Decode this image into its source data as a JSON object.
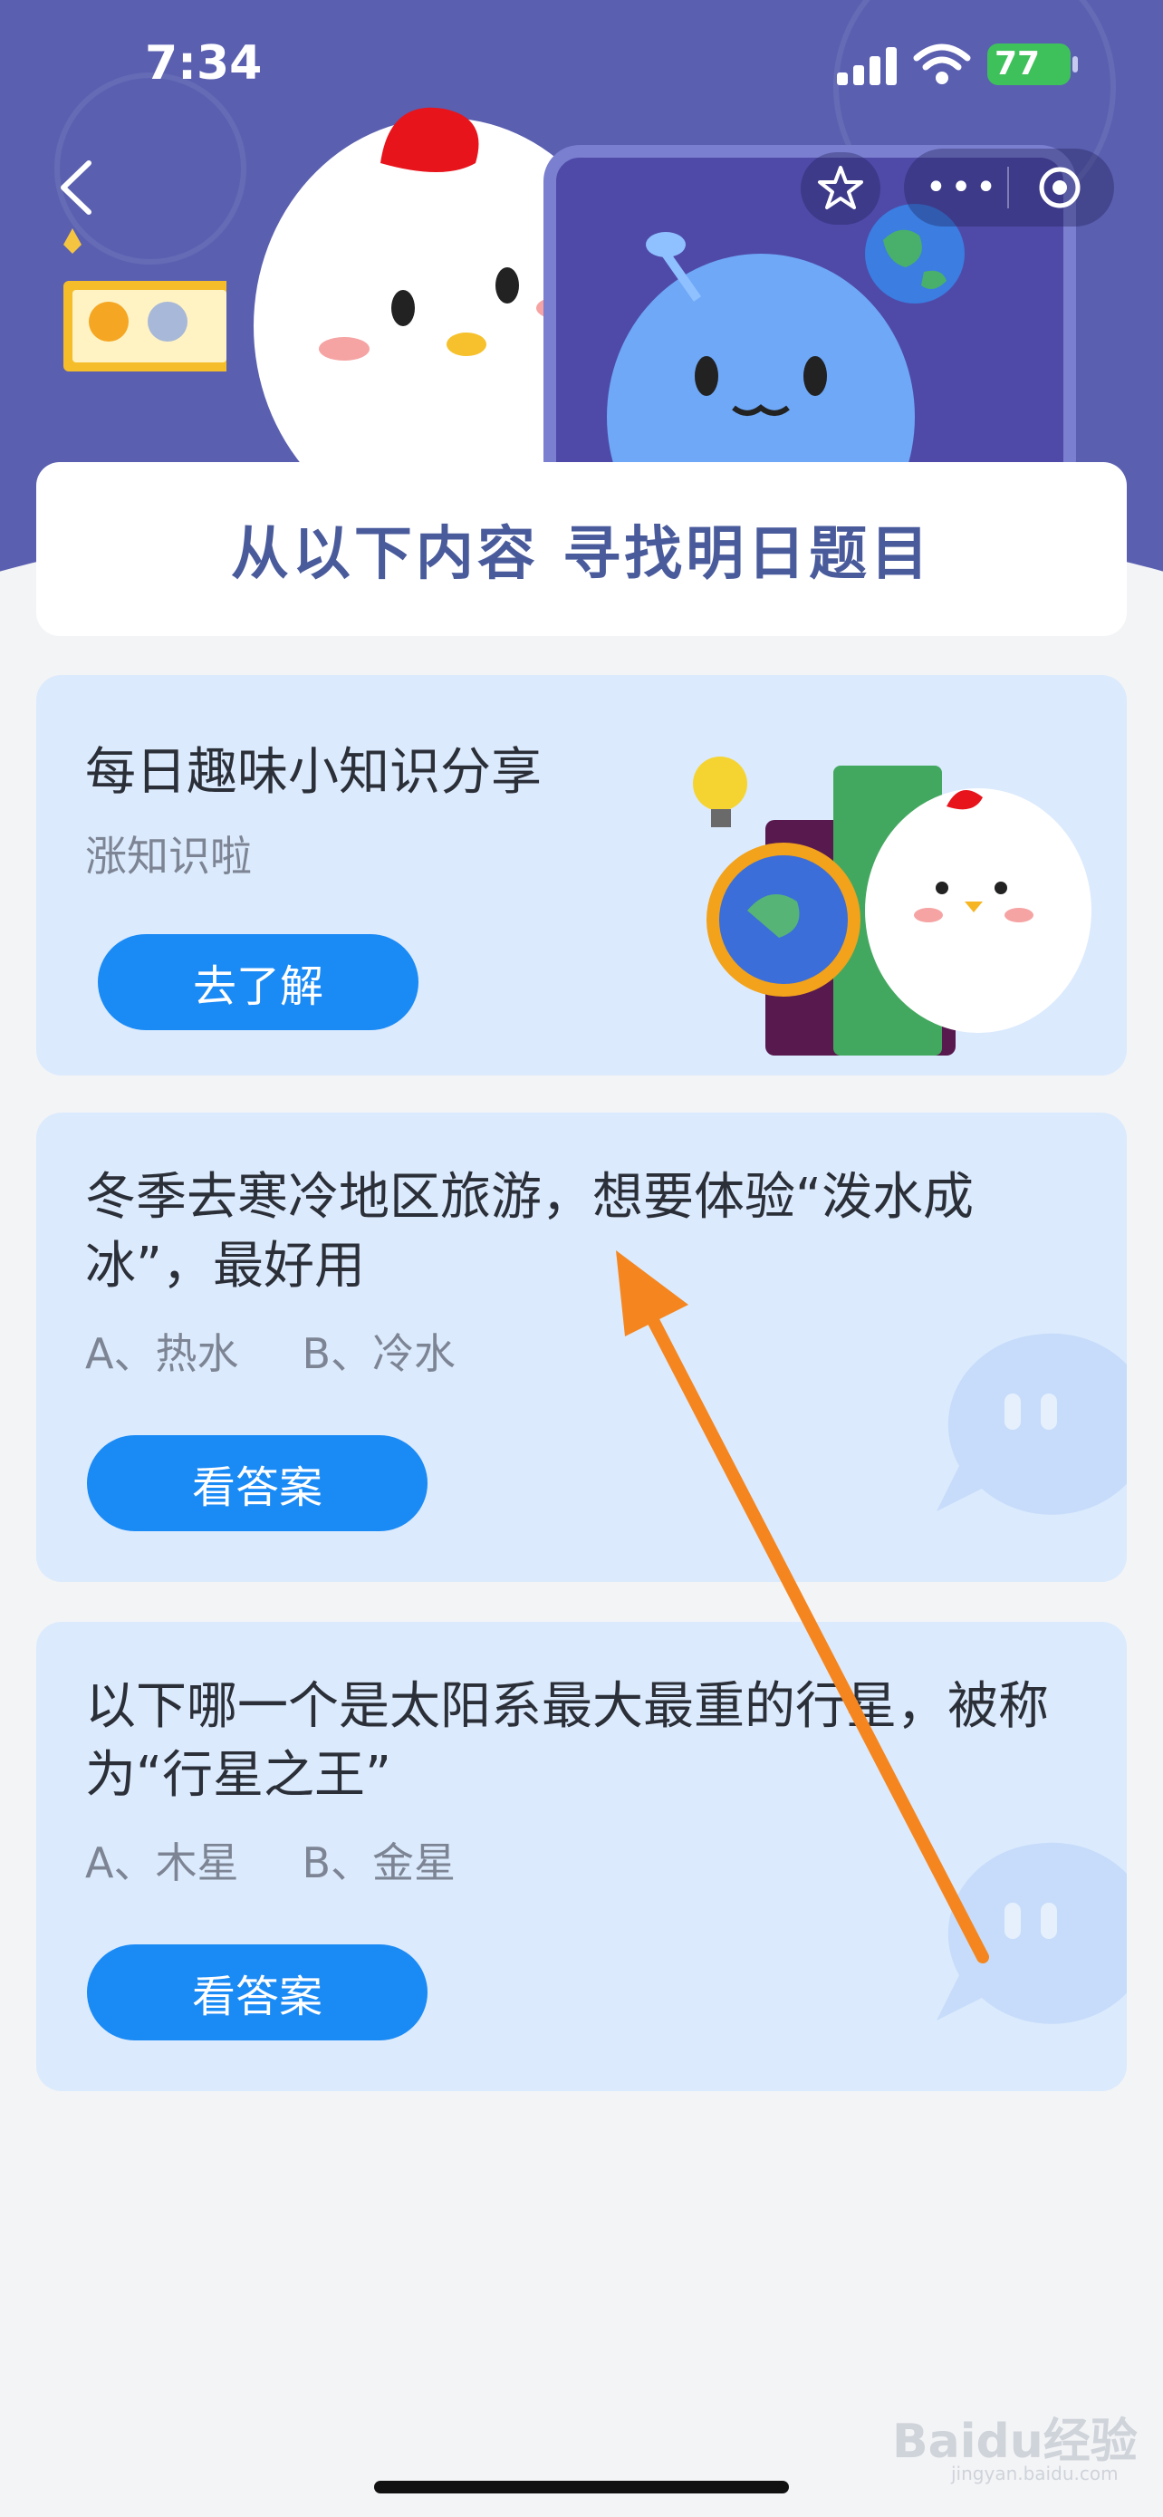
{
  "status_bar": {
    "time": "7:34",
    "battery": "77"
  },
  "nav": {
    "menu_dots": "•••"
  },
  "banner": {
    "title": "从以下内容  寻找明日题目"
  },
  "daily_card": {
    "title": "每日趣味小知识分享",
    "subtitle": "涨知识啦",
    "button": "去了解"
  },
  "questions": [
    {
      "question": "冬季去寒冷地区旅游，想要体验“泼水成冰”，最好用",
      "option_a": "A、热水",
      "option_b": "B、冷水",
      "button": "看答案"
    },
    {
      "question": "以下哪一个是太阳系最大最重的行星，被称为“行星之王”",
      "option_a": "A、木星",
      "option_b": "B、金星",
      "button": "看答案"
    }
  ],
  "watermark": {
    "text": "Baidu经验",
    "sub": "jingyan.baidu.com"
  },
  "colors": {
    "header": "#5a5fb0",
    "card": "#dbeafd",
    "button": "#1a8af5",
    "arrow": "#f5861f"
  },
  "icons": [
    "back-icon",
    "star-icon",
    "more-icon",
    "target-icon",
    "signal-icon",
    "wifi-icon",
    "battery-icon"
  ]
}
